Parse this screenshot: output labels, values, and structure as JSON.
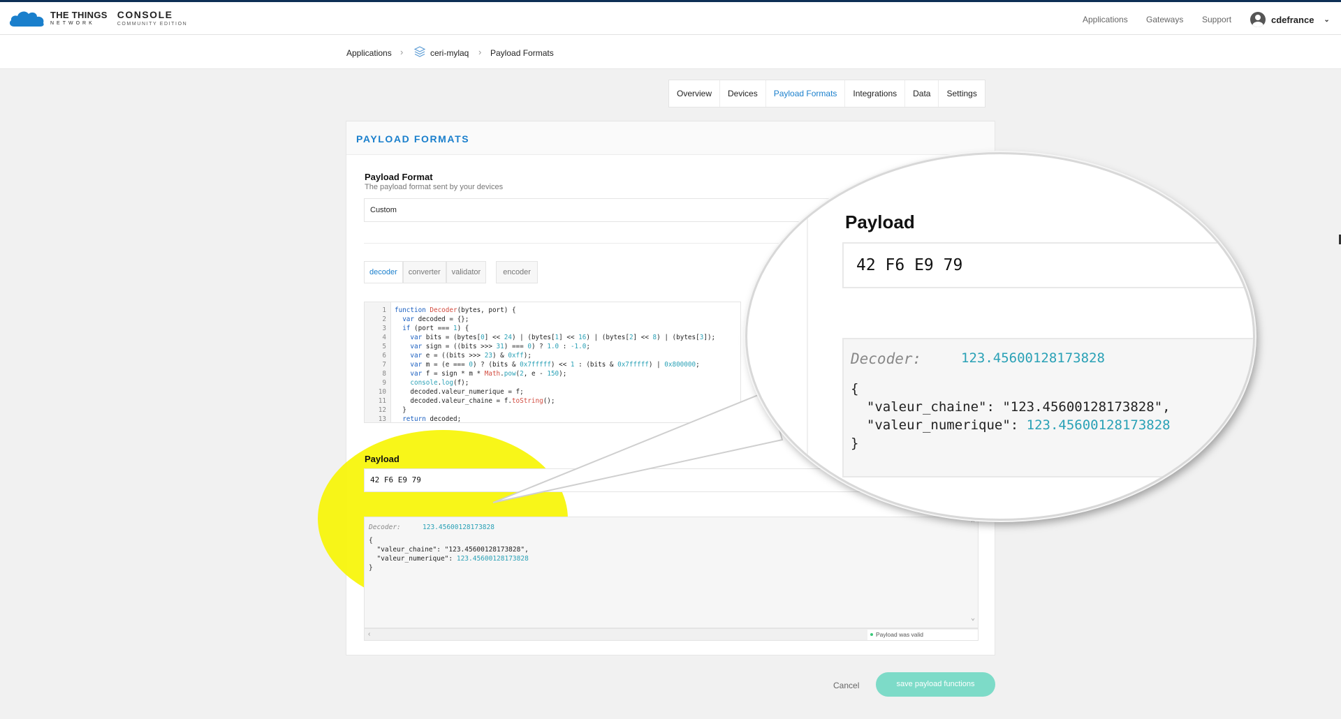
{
  "header": {
    "logo_line1": "THE THINGS",
    "logo_line2": "NETWORK",
    "console_title": "CONSOLE",
    "console_sub": "COMMUNITY EDITION",
    "nav": [
      "Applications",
      "Gateways",
      "Support"
    ],
    "username": "cdefrance"
  },
  "breadcrumb": {
    "items": [
      "Applications",
      "ceri-mylaq",
      "Payload Formats"
    ]
  },
  "tabs": [
    "Overview",
    "Devices",
    "Payload Formats",
    "Integrations",
    "Data",
    "Settings"
  ],
  "active_tab": "Payload Formats",
  "panel": {
    "title": "PAYLOAD FORMATS",
    "payload_format_label": "Payload Format",
    "payload_format_sub": "The payload format sent by your devices",
    "payload_format_value": "Custom",
    "function_buttons": [
      "decoder",
      "converter",
      "validator"
    ],
    "encoder_button": "encoder",
    "payload_label": "Payload",
    "payload_value": "42 F6 E9 79",
    "decoder_label": "Decoder:",
    "decoder_value": "123.45600128173828",
    "status_text": "Payload was valid"
  },
  "actions": {
    "cancel": "Cancel",
    "save": "save payload functions"
  },
  "colors": {
    "accent": "#1a7fcc",
    "save_button": "#7ddbc8",
    "highlight": "#f7f500",
    "header_border": "#0d2f55"
  }
}
